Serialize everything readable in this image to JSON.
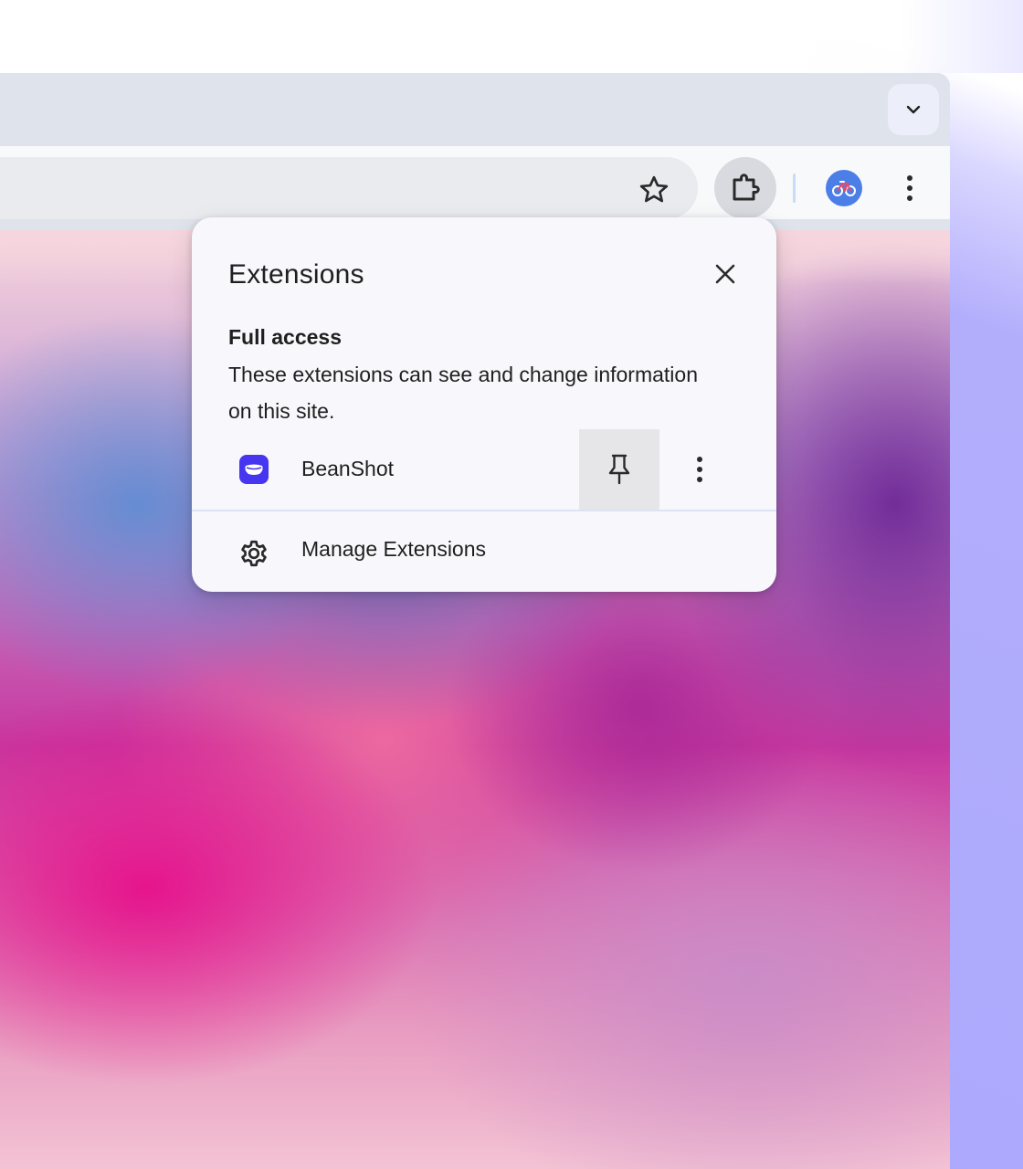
{
  "browser": {
    "tabstrip": {
      "tab_search_icon": "chevron-down-icon"
    },
    "toolbar": {
      "bookmark_icon": "star-icon",
      "extensions_icon": "puzzle-piece-icon",
      "profile_avatar_icon": "bicycle-icon",
      "menu_icon": "vertical-dots-icon"
    }
  },
  "extensions_popup": {
    "title": "Extensions",
    "close_icon": "close-icon",
    "section_heading": "Full access",
    "section_description": "These extensions can see and change information on this site.",
    "extensions": [
      {
        "name": "BeanShot",
        "icon": "beanshot-icon",
        "pin_icon": "pin-icon",
        "more_icon": "vertical-dots-icon"
      }
    ],
    "manage": {
      "label": "Manage Extensions",
      "icon": "gear-icon"
    }
  },
  "colors": {
    "accent": "#4736f0",
    "avatar": "#4c7ee8",
    "popup_background": "#f8f7fb",
    "tabstrip": "#dfe3ec"
  }
}
